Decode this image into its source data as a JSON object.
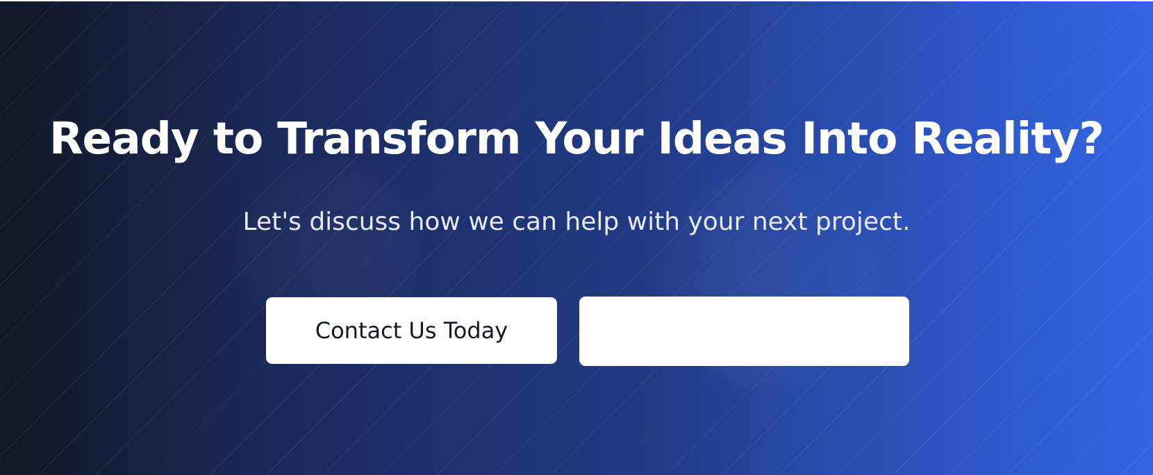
{
  "cta": {
    "title": "Ready to Transform Your Ideas Into Reality?",
    "subtitle": "Let's discuss how we can help with your next project.",
    "primary_button_label": "Contact Us Today",
    "secondary_button_label": ""
  },
  "colors": {
    "gradient_start": "#111827",
    "gradient_end": "#3466e3",
    "title_text": "#ffffff",
    "button_background": "#ffffff",
    "button_text": "#111827"
  }
}
